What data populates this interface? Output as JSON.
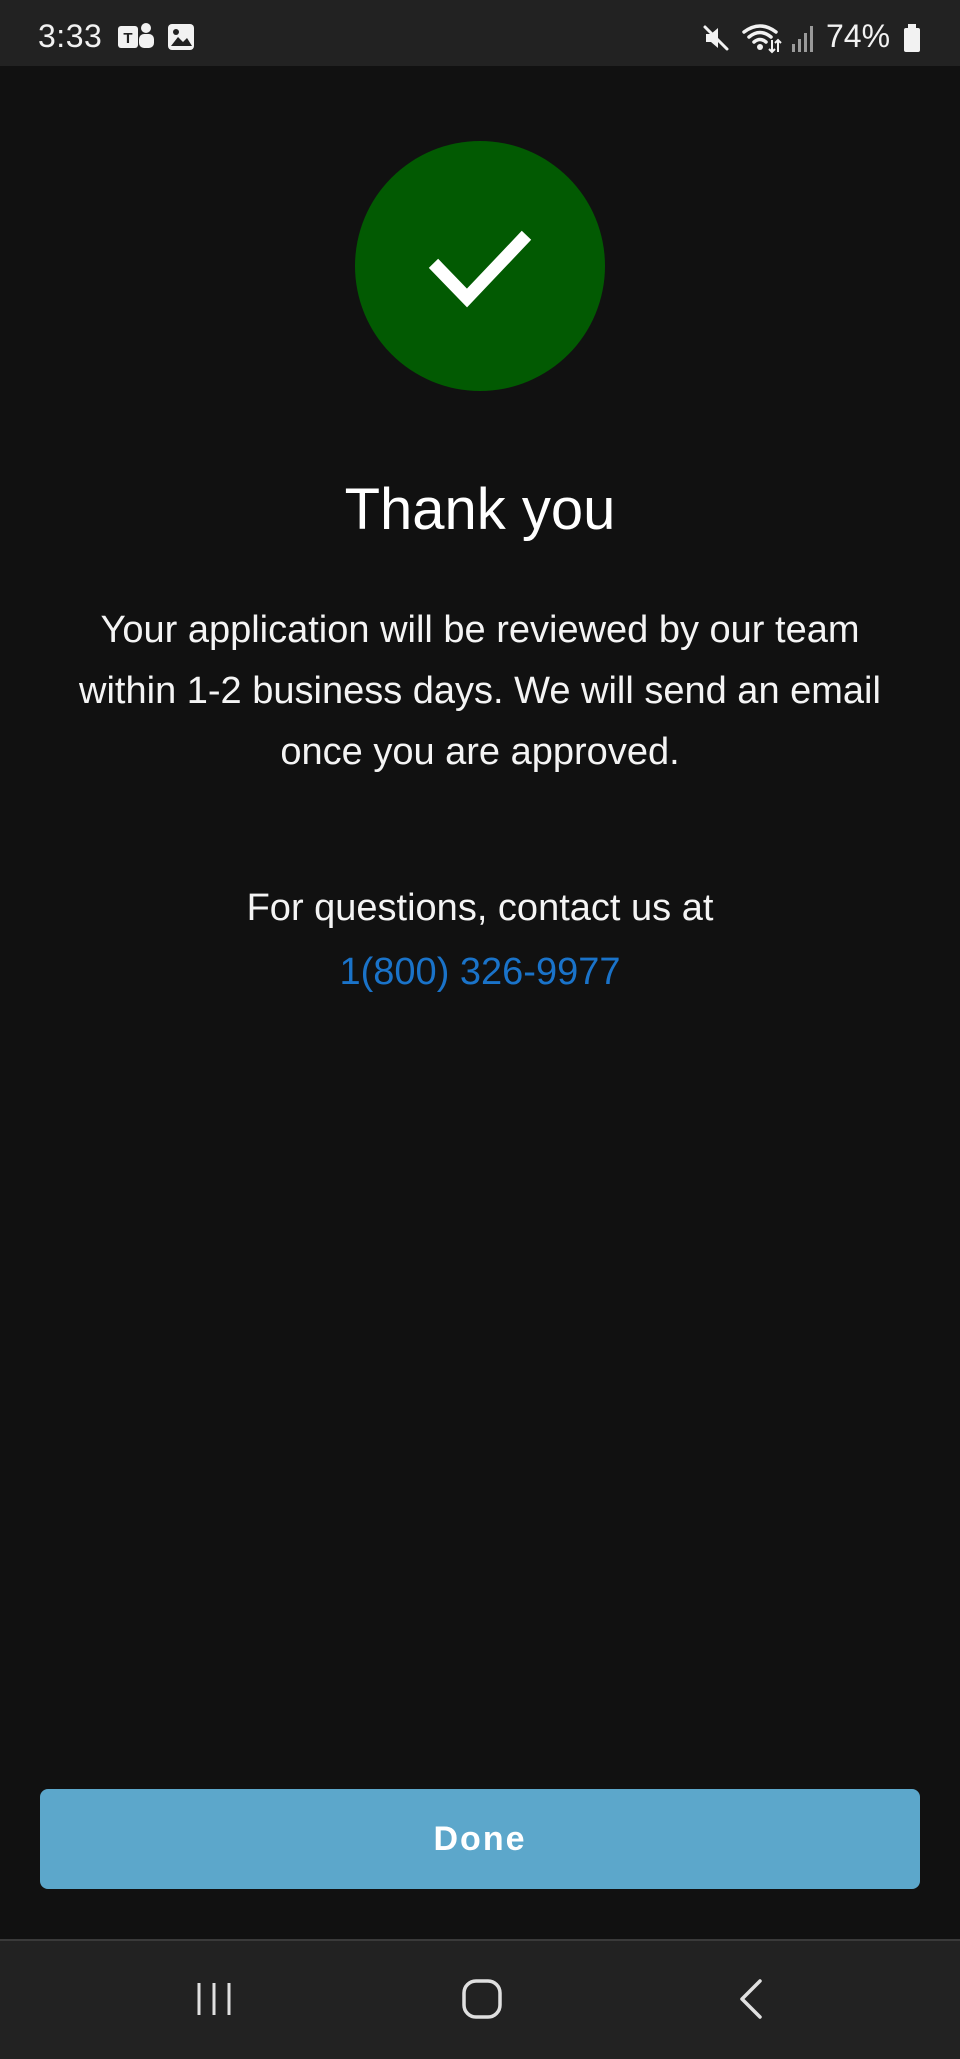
{
  "status_bar": {
    "time": "3:33",
    "battery_percent": "74%",
    "icons": [
      "teams-icon",
      "gallery-icon",
      "mute-icon",
      "wifi-icon",
      "signal-icon",
      "battery-icon"
    ]
  },
  "confirmation": {
    "icon": "checkmark-icon",
    "icon_color": "#025a02",
    "title": "Thank you",
    "message": "Your application will be reviewed by our team within 1-2 business days. We will send an email once you are approved.",
    "contact_label": "For questions, contact us at",
    "contact_phone": "1(800) 326-9977",
    "link_color": "#1a73c9"
  },
  "actions": {
    "done_label": "Done",
    "button_color": "#5ca7cb"
  },
  "navigation": {
    "buttons": [
      "recent-apps-icon",
      "home-icon",
      "back-icon"
    ]
  }
}
